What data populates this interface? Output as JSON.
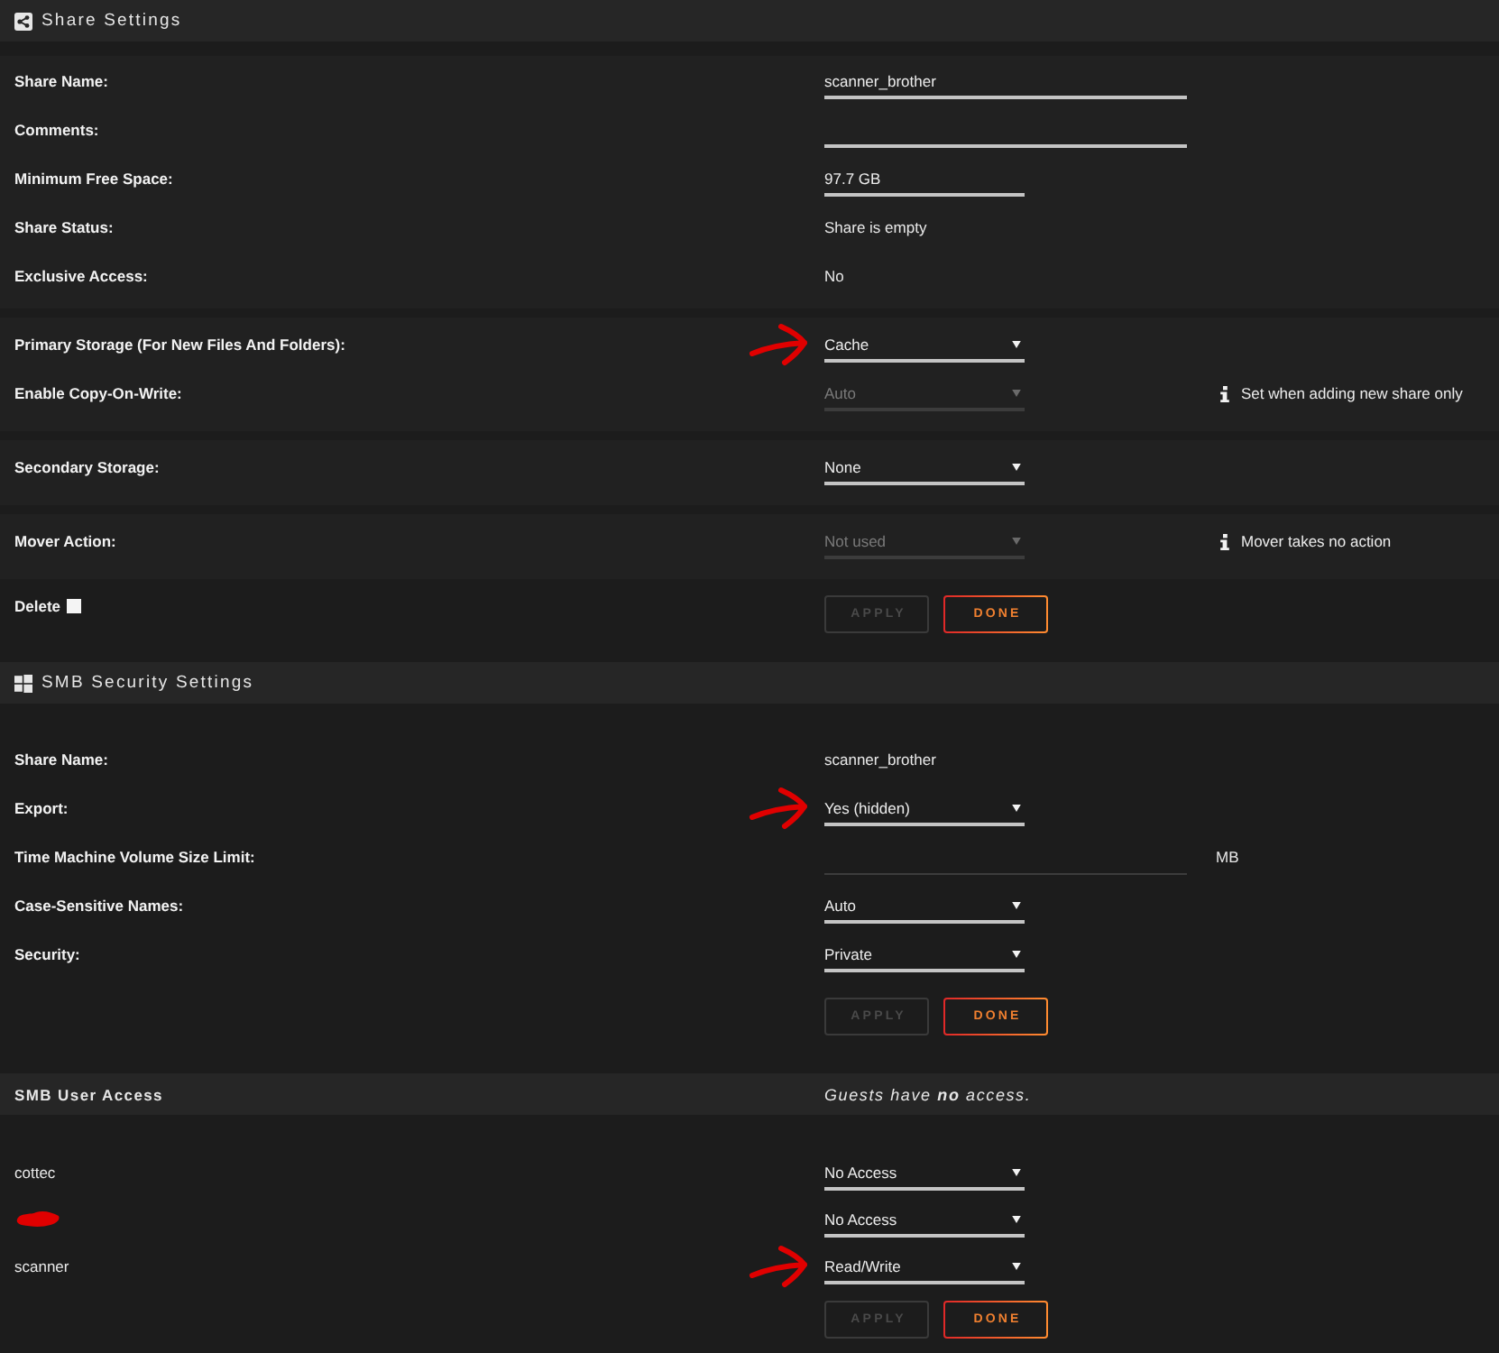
{
  "share_settings": {
    "title": "Share Settings",
    "groups": [
      {
        "rows": [
          {
            "label": "Share Name:",
            "kind": "text-field",
            "value": "scanner_brother",
            "disabled": false,
            "annotated": false
          },
          {
            "label": "Comments:",
            "kind": "text-field",
            "disabled": false,
            "annotated": false
          },
          {
            "label": "Minimum Free Space:",
            "kind": "size-field",
            "value": "97.7 GB",
            "disabled": false,
            "annotated": false
          },
          {
            "label": "Share Status:",
            "kind": "text",
            "value": "Share is empty",
            "annotated": false
          },
          {
            "label": "Exclusive Access:",
            "kind": "text",
            "value": "No",
            "annotated": false
          }
        ]
      },
      {
        "rows": [
          {
            "label": "Primary Storage (For New Files And Folders):",
            "kind": "select",
            "value": "Cache",
            "disabled": false,
            "annotated": true
          },
          {
            "label": "Enable Copy-On-Write:",
            "kind": "select",
            "value": "Auto",
            "disabled": true,
            "annotated": false,
            "note": "Set when adding new share only"
          }
        ]
      },
      {
        "rows": [
          {
            "label": "Secondary Storage:",
            "kind": "select",
            "value": "None",
            "disabled": false,
            "annotated": false
          }
        ]
      },
      {
        "rows": [
          {
            "label": "Mover Action:",
            "kind": "select",
            "value": "Not used",
            "disabled": true,
            "annotated": false,
            "note": "Mover takes no action"
          }
        ]
      }
    ],
    "delete": {
      "label": "Delete",
      "checked": false
    },
    "buttons": [
      {
        "label": "APPLY",
        "disabled": true
      },
      {
        "label": "DONE",
        "disabled": false
      }
    ]
  },
  "smb_security": {
    "title": "SMB Security Settings",
    "rows": [
      {
        "label": "Share Name:",
        "kind": "text",
        "value": "scanner_brother",
        "annotated": false
      },
      {
        "label": "Export:",
        "kind": "select",
        "value": "Yes (hidden)",
        "disabled": false,
        "annotated": true
      },
      {
        "label": "Time Machine Volume Size Limit:",
        "kind": "text-field",
        "disabled": true,
        "annotated": false,
        "unit": "MB"
      },
      {
        "label": "Case-Sensitive Names:",
        "kind": "select",
        "value": "Auto",
        "disabled": false,
        "annotated": false
      },
      {
        "label": "Security:",
        "kind": "select",
        "value": "Private",
        "disabled": false,
        "annotated": false
      }
    ],
    "buttons": [
      {
        "label": "APPLY",
        "disabled": true
      },
      {
        "label": "DONE",
        "disabled": false
      }
    ]
  },
  "smb_user_access": {
    "title": "SMB User Access",
    "guest_note": "Guests have **no** access.",
    "users": [
      {
        "name": "cottec",
        "redacted": false,
        "access": "No Access",
        "disabled": false,
        "annotated": false
      },
      {
        "redacted": true,
        "access": "No Access",
        "disabled": false,
        "annotated": false
      },
      {
        "name": "scanner",
        "redacted": false,
        "access": "Read/Write",
        "disabled": false,
        "annotated": true
      }
    ],
    "buttons": [
      {
        "label": "APPLY",
        "disabled": true
      },
      {
        "label": "DONE",
        "disabled": false
      }
    ]
  }
}
